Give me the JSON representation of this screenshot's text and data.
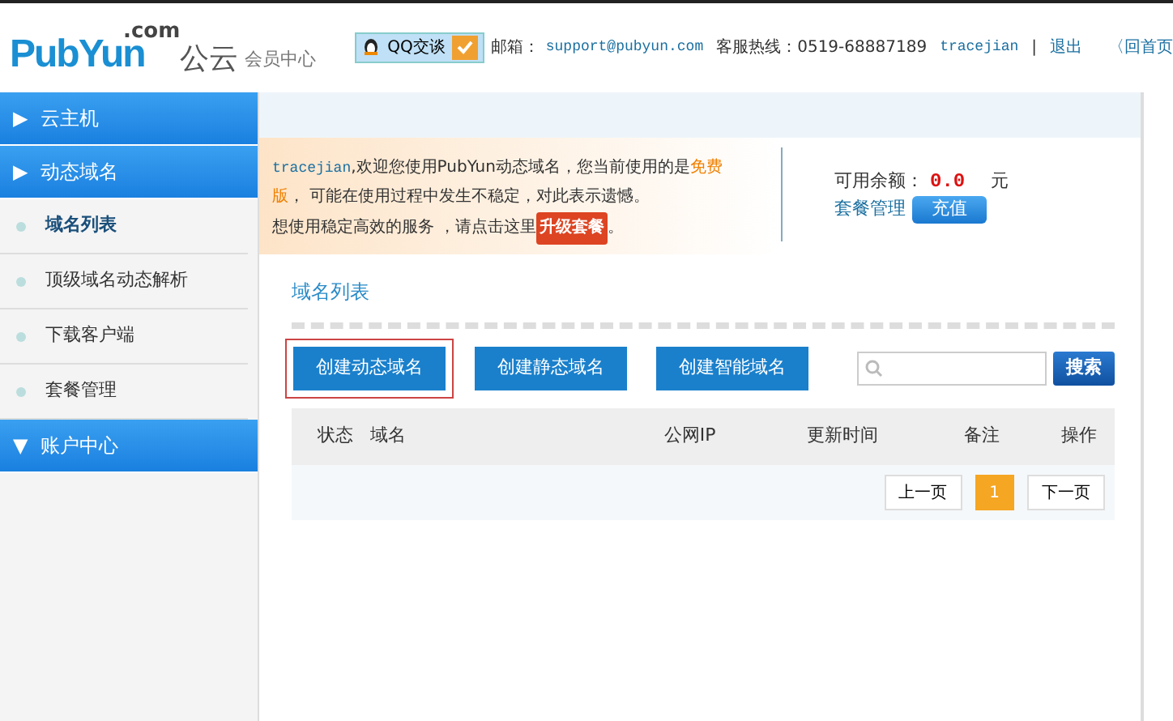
{
  "header": {
    "logo_domain": ".com",
    "logo": "PubYun",
    "logo_cn": "公云",
    "subtitle": "会员中心",
    "qq_button": "QQ交谈",
    "email_label": "邮箱：",
    "email": "support@pubyun.com",
    "hotline": "客服热线：0519-68887189",
    "user": "tracejian",
    "separator": "|",
    "logout": "退出",
    "home": "〈回首页"
  },
  "sidebar": [
    {
      "label": "云主机",
      "arrow": "▶"
    },
    {
      "label": "动态域名",
      "arrow": "▶",
      "children": [
        {
          "label": "域名列表",
          "selected": true
        },
        {
          "label": "顶级域名动态解析",
          "selected": false
        },
        {
          "label": "下载客户端",
          "selected": false
        },
        {
          "label": "套餐管理",
          "selected": false
        }
      ]
    },
    {
      "label": "账户中心",
      "arrow": "▼"
    }
  ],
  "notice": {
    "user": "tracejian",
    "text": ",欢迎您使用PubYun动态域名，您当前使用的是",
    "plan": "免费版",
    "text_2": "， 可能在使用过程中发生不稳定，对此表示遗憾。",
    "line_2": "想使用稳定高效的服务 ，请点击这里",
    "upgrade_button": "升级套餐",
    "end": "。"
  },
  "balance": {
    "label": "可用余额：",
    "amount": "0.0",
    "unit": "元",
    "plan_link": "套餐管理",
    "recharge_button": "充值"
  },
  "section_title": "域名列表",
  "create_buttons": [
    {
      "label": "创建动态域名",
      "selected": true
    },
    {
      "label": "创建静态域名",
      "selected": false
    },
    {
      "label": "创建智能域名",
      "selected": false
    }
  ],
  "search_button": "搜索",
  "table": {
    "columns": [
      "状态",
      "域名",
      "公网IP",
      "更新时间",
      "备注",
      "操作"
    ]
  },
  "pagination": {
    "prev": "上一页",
    "pages": [
      {
        "label": "1",
        "selected": true
      }
    ],
    "next": "下一页"
  }
}
